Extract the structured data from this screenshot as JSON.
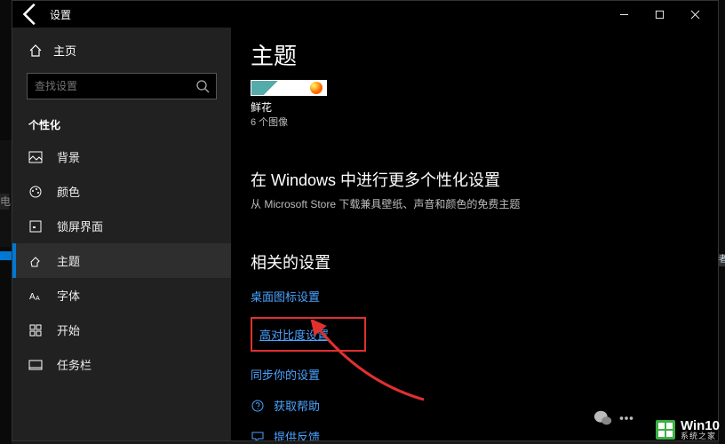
{
  "titlebar": {
    "title": "设置"
  },
  "sidebar": {
    "home": "主页",
    "search_placeholder": "查找设置",
    "section": "个性化",
    "items": [
      {
        "label": "背景"
      },
      {
        "label": "颜色"
      },
      {
        "label": "锁屏界面"
      },
      {
        "label": "主题"
      },
      {
        "label": "字体"
      },
      {
        "label": "开始"
      },
      {
        "label": "任务栏"
      }
    ]
  },
  "content": {
    "heading": "主题",
    "theme_name": "鲜花",
    "theme_sub": "6 个图像",
    "more_heading": "在 Windows 中进行更多个性化设置",
    "more_desc": "从 Microsoft Store 下载兼具壁纸、声音和颜色的免费主题",
    "related_heading": "相关的设置",
    "link_desktop_icons": "桌面图标设置",
    "link_high_contrast": "高对比度设置",
    "link_sync": "同步你的设置",
    "link_help": "获取帮助",
    "link_feedback": "提供反馈"
  },
  "left_strip": {
    "char": "电"
  },
  "right_strip": {
    "char": "者"
  },
  "watermark": {
    "brand": "Win10",
    "site": "系统之家"
  }
}
